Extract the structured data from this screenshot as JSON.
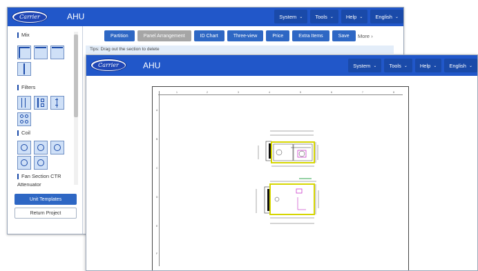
{
  "back_window": {
    "logo_text": "Carrier",
    "app_title": "AHU",
    "menu": [
      {
        "label": "System"
      },
      {
        "label": "Tools"
      },
      {
        "label": "Help"
      },
      {
        "label": "English"
      }
    ],
    "sidebar": {
      "sections": [
        "Mix",
        "Filters",
        "Coil",
        "Fan Section  CTR"
      ],
      "extra_label": "Attenuator",
      "unit_templates": "Unit Templates",
      "return_project": "Return Project"
    },
    "toolbar": [
      "Partition",
      "Panel Arrangement",
      "ID Chart",
      "Three-view",
      "Price",
      "Extra Items",
      "Save"
    ],
    "active_tab": "Panel Arrangement",
    "more": "More",
    "tips": "Tips: Drag out the section to delete"
  },
  "front_window": {
    "logo_text": "Carrier",
    "app_title": "AHU",
    "menu": [
      {
        "label": "System"
      },
      {
        "label": "Tools"
      },
      {
        "label": "Help"
      },
      {
        "label": "English"
      }
    ],
    "ruler_cols": [
      "1",
      "2",
      "3",
      "4",
      "5",
      "6",
      "7",
      "8"
    ],
    "ruler_rows": [
      "A",
      "B",
      "C",
      "D",
      "E",
      "F"
    ]
  },
  "colors": {
    "brand_blue": "#2157c9",
    "button_blue": "#2e67c4",
    "active_gray": "#a6a6a6",
    "highlight_yellow": "#e6e600"
  }
}
